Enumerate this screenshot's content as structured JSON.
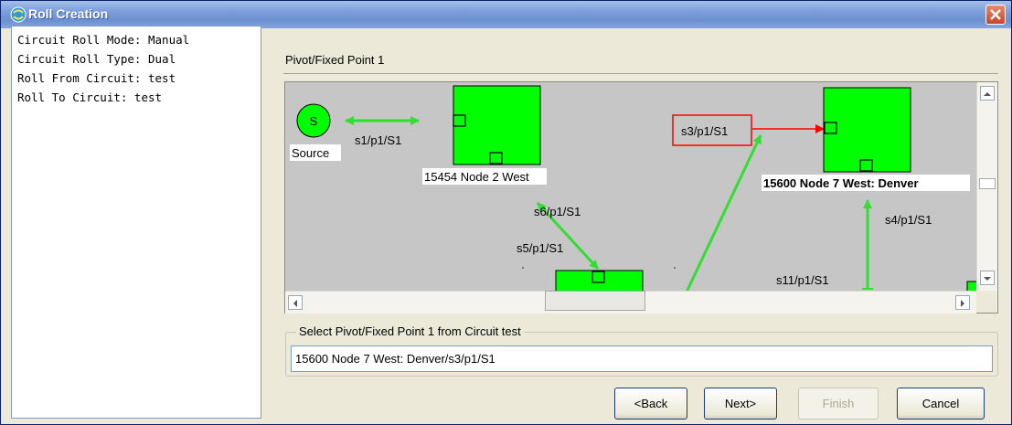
{
  "window": {
    "title": "Roll Creation",
    "icons": {
      "app": "app-icon",
      "close": "close-icon"
    }
  },
  "info": {
    "lines": [
      "Circuit Roll Mode: Manual",
      "Circuit Roll Type: Dual",
      "Roll From Circuit: test",
      "Roll To Circuit: test"
    ]
  },
  "pivot": {
    "section_title": "Pivot/Fixed Point 1"
  },
  "map": {
    "nodes": {
      "source_symbol": "S",
      "source_label": "Source",
      "node2_label": "15454 Node 2 West",
      "node7_label": "15600 Node 7 West: Denver"
    },
    "links": {
      "s1": "s1/p1/S1",
      "s3": "s3/p1/S1",
      "s6": "s6/p1/S1",
      "s5": "s5/p1/S1",
      "s4": "s4/p1/S1",
      "s11": "s11/p1/S1"
    },
    "colors": {
      "node": "#00ff00",
      "link": "#33dd33",
      "selected_link": "#ff0000",
      "canvas": "#c6c6c6"
    }
  },
  "select": {
    "label": "Select Pivot/Fixed Point 1 from Circuit test",
    "value": "15600 Node 7 West: Denver/s3/p1/S1"
  },
  "buttons": {
    "back": "<Back",
    "next": "Next>",
    "finish": "Finish",
    "cancel": "Cancel"
  }
}
